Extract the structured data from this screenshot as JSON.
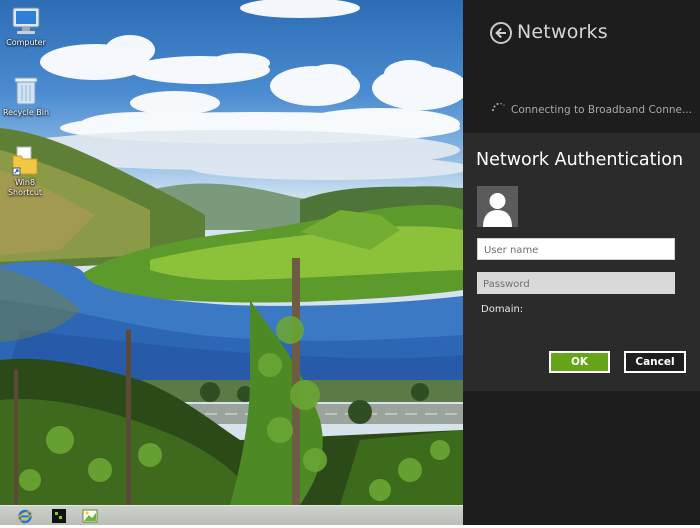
{
  "desktop": {
    "icons": [
      {
        "label": "Computer",
        "icon": "computer-icon"
      },
      {
        "label": "Recycle Bin",
        "icon": "recycle-bin-icon"
      },
      {
        "label": "Win8 Shortcut",
        "icon": "folder-shortcut-icon"
      }
    ]
  },
  "taskbar": {
    "items": [
      {
        "icon": "internet-explorer-icon"
      },
      {
        "icon": "terminal-icon"
      },
      {
        "icon": "paint-icon"
      }
    ]
  },
  "panel": {
    "title": "Networks",
    "status_text": "Connecting to Broadband Conne...",
    "auth": {
      "title": "Network Authentication",
      "username_placeholder": "User name",
      "username_value": "",
      "password_placeholder": "Password",
      "password_value": "",
      "domain_label": "Domain:",
      "ok_label": "OK",
      "cancel_label": "Cancel"
    }
  },
  "colors": {
    "panel_bg": "#1d1d1d",
    "auth_bg": "#2b2b2b",
    "ok_green": "#66a51a"
  }
}
